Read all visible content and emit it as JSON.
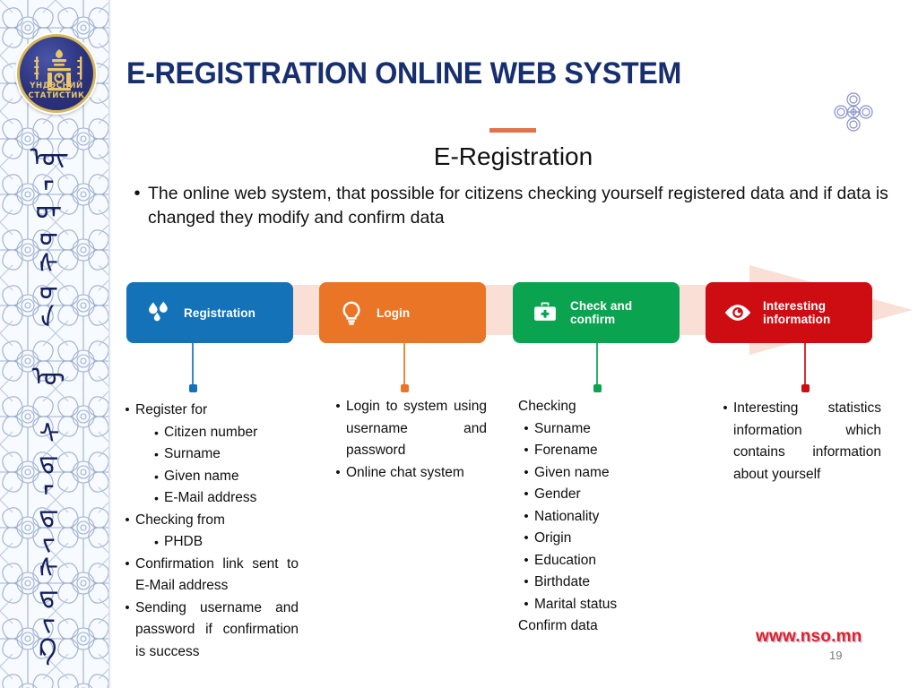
{
  "slide": {
    "title": "E-REGISTRATION ONLINE WEB SYSTEM",
    "subtitle": "E-Registration",
    "accent_color": "#e2714d",
    "title_color": "#172f6e"
  },
  "sidebar": {
    "logo": {
      "name": "national-statistics-emblem",
      "text_line1": "ҮНДЭСНИЙ",
      "text_line2": "СТАТИСТИК"
    },
    "vertical_script": "ᠦᠨᠳᠦᠰᠦᠨ ᠦ ᠰᠲ᠋ᠠᠲ᠋ᠢᠰᠲ᠋ᠢᠺ"
  },
  "ornament": {
    "name": "four-lobed-ornament",
    "color": "#8a90c8"
  },
  "lead": {
    "bullet": "•",
    "text": "The online web system, that possible for citizens checking yourself registered data and if data is changed they modify and confirm data"
  },
  "process": {
    "band_color": "#fadfd6",
    "boxes": [
      {
        "label": "Registration",
        "color": "#1372b8",
        "icon": "water-drops-icon",
        "dot_color": "#1372b8"
      },
      {
        "label": "Login",
        "color": "#ea7527",
        "icon": "lightbulb-icon",
        "dot_color": "#ea7527"
      },
      {
        "label": "Check and\nconfirm",
        "color": "#0aa350",
        "icon": "medical-briefcase-icon",
        "dot_color": "#0aa350"
      },
      {
        "label": "Interesting\ninformation",
        "color": "#ce0d12",
        "icon": "eye-icon",
        "dot_color": "#ce0d12"
      }
    ]
  },
  "columns": [
    {
      "name": "registration-details",
      "items": [
        {
          "level": 1,
          "bullet": "•",
          "text": "Register for"
        },
        {
          "level": 2,
          "bullet": "•",
          "text": "Citizen number"
        },
        {
          "level": 2,
          "bullet": "•",
          "text": "Surname"
        },
        {
          "level": 2,
          "bullet": "•",
          "text": "Given name"
        },
        {
          "level": 2,
          "bullet": "•",
          "text": "E-Mail address"
        },
        {
          "level": 1,
          "bullet": "•",
          "text": "Checking from"
        },
        {
          "level": 2,
          "bullet": "•",
          "text": "PHDB"
        },
        {
          "level": 1,
          "bullet": "•",
          "text": "Confirmation link sent to E-Mail address",
          "justify": true
        },
        {
          "level": 1,
          "bullet": "•",
          "text": "Sending username and password if confirmation is success",
          "justify": true
        }
      ]
    },
    {
      "name": "login-details",
      "items": [
        {
          "level": 1,
          "bullet": "•",
          "text": "Login to system using username and password",
          "justify": true
        },
        {
          "level": 1,
          "bullet": "•",
          "text": "Online chat system"
        }
      ]
    },
    {
      "name": "check-confirm-details",
      "items": [
        {
          "level": 0,
          "bullet": "",
          "text": "Checking"
        },
        {
          "level": 1,
          "bullet": "•",
          "text": "Surname"
        },
        {
          "level": 1,
          "bullet": "•",
          "text": "Forename"
        },
        {
          "level": 1,
          "bullet": "•",
          "text": "Given name"
        },
        {
          "level": 1,
          "bullet": "•",
          "text": "Gender"
        },
        {
          "level": 1,
          "bullet": "•",
          "text": "Nationality"
        },
        {
          "level": 1,
          "bullet": "•",
          "text": "Origin"
        },
        {
          "level": 1,
          "bullet": "•",
          "text": "Education"
        },
        {
          "level": 1,
          "bullet": "•",
          "text": "Birthdate"
        },
        {
          "level": 1,
          "bullet": "•",
          "text": "Marital status"
        },
        {
          "level": 0,
          "bullet": "",
          "text": "Confirm data"
        }
      ]
    },
    {
      "name": "interesting-information-details",
      "items": [
        {
          "level": 1,
          "bullet": "•",
          "text": "Interesting statistics information which contains information about yourself",
          "justify": true
        }
      ]
    }
  ],
  "footer": {
    "url": "www.nso.mn",
    "url_color": "#e0202a",
    "page_number": "19"
  }
}
